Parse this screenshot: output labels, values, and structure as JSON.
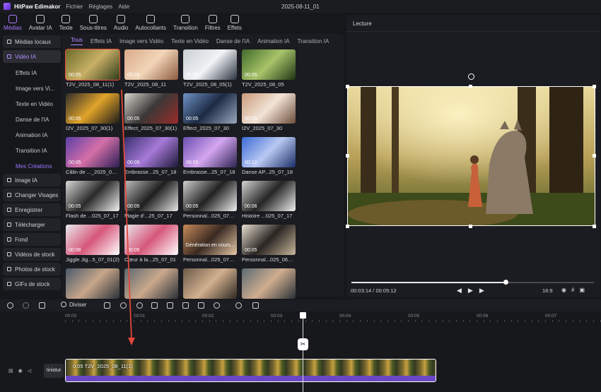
{
  "app": {
    "name": "HitPaw Edimakor",
    "doc_title": "2025-08-11_01"
  },
  "menu": [
    "Fichier",
    "Réglages",
    "Aide"
  ],
  "toolbar": [
    {
      "label": "Médias",
      "icon": "media-icon",
      "active": true
    },
    {
      "label": "Avatar IA",
      "icon": "avatar-icon",
      "active": false
    },
    {
      "label": "Texte",
      "icon": "text-icon",
      "active": false
    },
    {
      "label": "Sous-titres",
      "icon": "subtitles-icon",
      "active": false
    },
    {
      "label": "Audio",
      "icon": "audio-icon",
      "active": false
    },
    {
      "label": "Autocollants",
      "icon": "sticker-icon",
      "active": false
    },
    {
      "label": "Transition",
      "icon": "transition-icon",
      "active": false
    },
    {
      "label": "Filtres",
      "icon": "filter-icon",
      "active": false
    },
    {
      "label": "Effets",
      "icon": "effects-icon",
      "active": false
    }
  ],
  "leftnav": {
    "top": [
      {
        "label": "Médias locaux",
        "open": false
      },
      {
        "label": "Vidéo IA",
        "open": true
      }
    ],
    "sub": [
      {
        "label": "Effets IA",
        "purple": false
      },
      {
        "label": "Image vers Vi...",
        "purple": false
      },
      {
        "label": "Texte en Vidéo",
        "purple": false
      },
      {
        "label": "Danse de l'IA",
        "purple": false
      },
      {
        "label": "Animation IA",
        "purple": false
      },
      {
        "label": "Transition IA",
        "purple": false
      },
      {
        "label": "Mes Créations",
        "purple": true
      }
    ],
    "bottom": [
      {
        "label": "Image IA"
      },
      {
        "label": "Changer Visages"
      },
      {
        "label": "Enregistrer"
      },
      {
        "label": "Télécharger"
      },
      {
        "label": "Fond"
      },
      {
        "label": "Vidéos de stock"
      },
      {
        "label": "Photos de stock"
      },
      {
        "label": "GIFs de stock"
      }
    ]
  },
  "media_tabs": [
    "Tous",
    "Effets IA",
    "Image vers Vidéo",
    "Texte en Vidéo",
    "Danse de l'IA",
    "Animation IA",
    "Transition IA"
  ],
  "media_items": [
    {
      "label": "T2V_2025_08_11(1)",
      "duration": "00:05",
      "selected": true,
      "colors": [
        "#6a6b2a",
        "#c9b066",
        "#2f3b1a"
      ]
    },
    {
      "label": "T2V_2025_08_11",
      "duration": "00:05",
      "selected": false,
      "colors": [
        "#d9a98a",
        "#f2d5b8",
        "#8c5a3f"
      ]
    },
    {
      "label": "T2V_2025_08_05(1)",
      "duration": "00:05",
      "selected": false,
      "colors": [
        "#c8ced4",
        "#f1f3f5",
        "#2a3140"
      ]
    },
    {
      "label": "T2V_2025_08_05",
      "duration": "00:05",
      "selected": false,
      "colors": [
        "#3f6a2a",
        "#a9c46a",
        "#1e3514"
      ]
    },
    {
      "label": "I2V_2025_07_30(1)",
      "duration": "00:05",
      "selected": false,
      "colors": [
        "#2f2d2a",
        "#e0a32a",
        "#1b1a18"
      ]
    },
    {
      "label": "Effect_2025_07_30(1)",
      "duration": "00:05",
      "selected": false,
      "colors": [
        "#d8d4cf",
        "#3a3836",
        "#9a2b2b"
      ]
    },
    {
      "label": "Effect_2025_07_30",
      "duration": "00:05",
      "selected": false,
      "colors": [
        "#6f93c4",
        "#1c2a44",
        "#9aa9bf"
      ]
    },
    {
      "label": "I2V_2025_07_30",
      "duration": "00:05",
      "selected": false,
      "colors": [
        "#c99b7c",
        "#f2e3d6",
        "#6b4c3a"
      ]
    },
    {
      "label": "Câlin de ..._2025_07_18",
      "duration": "00:05",
      "selected": false,
      "colors": [
        "#5b3fa8",
        "#d56fa8",
        "#2a1e54"
      ]
    },
    {
      "label": "Embrasse...25_07_18",
      "duration": "00:05",
      "selected": false,
      "colors": [
        "#3b2f6e",
        "#a67ad8",
        "#1d1838"
      ]
    },
    {
      "label": "Embrasse...25_07_18",
      "duration": "00:05",
      "selected": false,
      "colors": [
        "#6a4fb0",
        "#d4a6f0",
        "#2c2250"
      ]
    },
    {
      "label": "Danse AP...25_07_18",
      "duration": "00:12",
      "selected": false,
      "colors": [
        "#3c6ad6",
        "#b9c9f2",
        "#1a2d66"
      ]
    },
    {
      "label": "Flash de ...025_07_17",
      "duration": "00:05",
      "selected": false,
      "colors": [
        "#d9d9d9",
        "#2a2a2a",
        "#f2f2f2"
      ]
    },
    {
      "label": "Magie d'...25_07_17",
      "duration": "00:05",
      "selected": false,
      "colors": [
        "#bfbfbf",
        "#1f1f1f",
        "#e6e6e6"
      ]
    },
    {
      "label": "Personnal...025_07_17",
      "duration": "00:05",
      "selected": false,
      "colors": [
        "#cfcfcf",
        "#222222",
        "#efefef"
      ]
    },
    {
      "label": "Histoire ...025_07_17",
      "duration": "00:06",
      "selected": false,
      "colors": [
        "#d4d4d4",
        "#252525",
        "#f0f0f0"
      ]
    },
    {
      "label": "Jiggle Jig...5_07_01(2)",
      "duration": "00:08",
      "selected": false,
      "colors": [
        "#e9e9ec",
        "#d6577a",
        "#ffffff"
      ]
    },
    {
      "label": "Cœur à la...25_07_01",
      "duration": "00:05",
      "selected": false,
      "colors": [
        "#e9e9ec",
        "#d6577a",
        "#ffffff"
      ]
    },
    {
      "label": "Personnal...025_07_17",
      "duration": "",
      "selected": false,
      "generating": true,
      "colors": [
        "#c78a5a",
        "#3a2a22",
        "#e8c8a8"
      ]
    },
    {
      "label": "Personnal...025_06_26",
      "duration": "00:05",
      "selected": false,
      "colors": [
        "#e8e0d2",
        "#2a2522",
        "#c9b79c"
      ]
    },
    {
      "label": "",
      "duration": "",
      "selected": false,
      "colors": [
        "#4a5a6a",
        "#c7a68a",
        "#2a3038"
      ]
    },
    {
      "label": "",
      "duration": "",
      "selected": false,
      "colors": [
        "#5a6670",
        "#caa88c",
        "#2b3138"
      ]
    },
    {
      "label": "",
      "duration": "",
      "selected": false,
      "colors": [
        "#6a5a4a",
        "#d2b08e",
        "#2e2822"
      ]
    },
    {
      "label": "",
      "duration": "",
      "selected": false,
      "colors": [
        "#5a6a72",
        "#d0ad90",
        "#2a3036"
      ]
    }
  ],
  "generating_text": "Génération en cours...",
  "preview": {
    "title": "Lecture",
    "current_time": "00:03:14",
    "total_time": "00:05:12",
    "progress": 0.635,
    "ratio": "16:9"
  },
  "timeline": {
    "split_label": "Diviser",
    "ruler": [
      "00:00",
      "00:01",
      "00:02",
      "00:03",
      "00:04",
      "00:05",
      "00:06",
      "00:07"
    ],
    "track_name": "Iinistur",
    "clip_label": "0:05  T2V_2025_08_11(1)"
  }
}
